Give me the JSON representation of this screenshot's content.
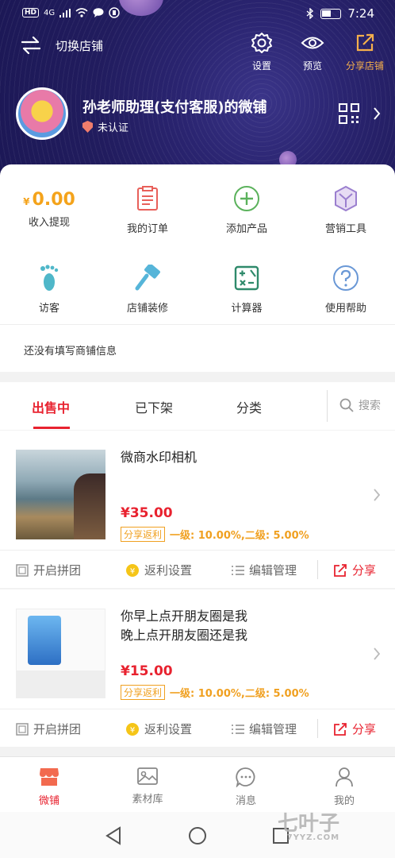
{
  "status_bar": {
    "network": "HD",
    "signal": "4G",
    "time": "7:24"
  },
  "header": {
    "switch_label": "切换店铺",
    "settings_label": "设置",
    "preview_label": "预览",
    "share_shop_label": "分享店铺",
    "shop_name": "孙老师助理(支付客服)的微铺",
    "auth_status": "未认证"
  },
  "dashboard": {
    "income": {
      "currency": "¥",
      "amount": "0.00",
      "label": "收入提现"
    },
    "items": [
      {
        "label": "我的订单",
        "icon": "order-icon"
      },
      {
        "label": "添加产品",
        "icon": "add-icon"
      },
      {
        "label": "营销工具",
        "icon": "marketing-icon"
      },
      {
        "label": "访客",
        "icon": "footprint-icon"
      },
      {
        "label": "店铺装修",
        "icon": "hammer-icon"
      },
      {
        "label": "计算器",
        "icon": "calculator-icon"
      },
      {
        "label": "使用帮助",
        "icon": "help-icon"
      }
    ],
    "notice": "还没有填写商铺信息"
  },
  "tabs": {
    "items": [
      "出售中",
      "已下架",
      "分类"
    ],
    "active": "出售中",
    "search_placeholder": "搜索"
  },
  "products": [
    {
      "title_line1": "微商水印相机",
      "title_line2": "",
      "price": "¥35.00",
      "rebate_tag": "分享返利",
      "rebate_text": "一级: 10.00%,二级: 5.00%"
    },
    {
      "title_line1": "你早上点开朋友圈是我",
      "title_line2": "晚上点开朋友圈还是我",
      "price": "¥15.00",
      "rebate_tag": "分享返利",
      "rebate_text": "一级: 10.00%,二级: 5.00%"
    }
  ],
  "product_actions": {
    "group_buy": "开启拼团",
    "rebate_settings": "返利设置",
    "edit": "编辑管理",
    "share": "分享"
  },
  "bottom_nav": {
    "items": [
      "微铺",
      "素材库",
      "消息",
      "我的"
    ],
    "active": "微铺"
  },
  "watermark": {
    "text": "七叶子",
    "sub": "7YYZ.COM"
  },
  "colors": {
    "accent": "#e8222f",
    "gold": "#f4a31b",
    "header_bg": "#211c5e"
  }
}
